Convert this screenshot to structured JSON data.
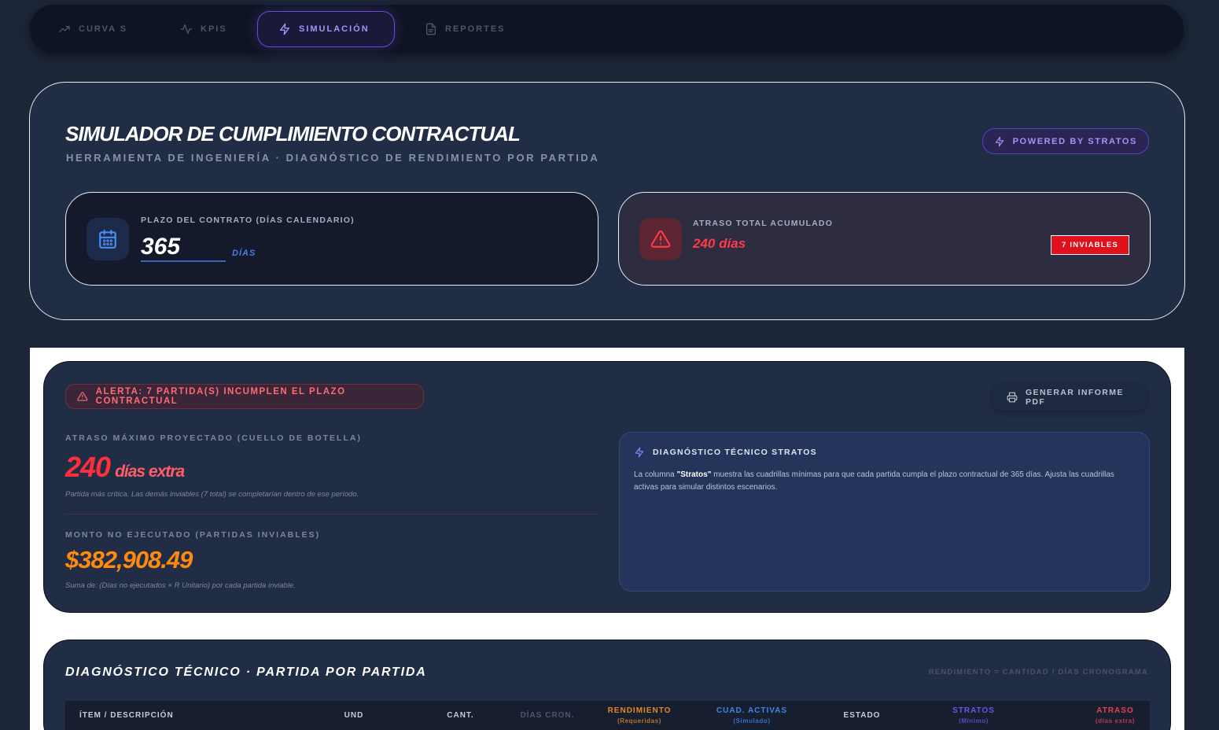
{
  "tabs": [
    {
      "label": "CURVA S",
      "icon": "trending-up-icon"
    },
    {
      "label": "KPIS",
      "icon": "activity-icon"
    },
    {
      "label": "SIMULACIÓN",
      "icon": "lightning-icon"
    },
    {
      "label": "REPORTES",
      "icon": "document-icon"
    }
  ],
  "header": {
    "title": "SIMULADOR DE CUMPLIMIENTO CONTRACTUAL",
    "subtitle": "HERRAMIENTA DE INGENIERÍA · DIAGNÓSTICO DE RENDIMIENTO POR PARTIDA",
    "powered": "POWERED BY STRATOS"
  },
  "contract": {
    "label": "PLAZO DEL CONTRATO (DÍAS CALENDARIO)",
    "value": "365",
    "unit": "DÍAS"
  },
  "delay": {
    "label": "ATRASO TOTAL ACUMULADO",
    "value": "240 días",
    "badge": "7 INVIABLES"
  },
  "alert": {
    "text": "ALERTA: 7 PARTIDA(S) INCUMPLEN EL PLAZO CONTRACTUAL",
    "pdf_button": "GENERAR INFORME PDF",
    "max_delay": {
      "label": "ATRASO MÁXIMO PROYECTADO (CUELLO DE BOTELLA)",
      "value": "240",
      "suffix": "días extra",
      "note": "Partida más crítica. Las demás inviables (7 total) se completarían dentro de ese período."
    },
    "amount": {
      "label": "MONTO NO EJECUTADO (PARTIDAS INVIABLES)",
      "value": "$382,908.49",
      "note": "Suma de: (Días no ejecutados × R Unitario) por cada partida inviable."
    },
    "diagnostic": {
      "title": "DIAGNÓSTICO TÉCNICO STRATOS",
      "text_before": "La columna ",
      "text_bold": "\"Stratos\"",
      "text_after": " muestra las cuadrillas mínimas para que cada partida cumpla el plazo contractual de 365 días. Ajusta las cuadrillas activas para simular distintos escenarios."
    }
  },
  "table": {
    "title": "DIAGNÓSTICO TÉCNICO · PARTIDA POR PARTIDA",
    "formula": "RENDIMIENTO = CANTIDAD / DÍAS CRONOGRAMA",
    "columns": [
      {
        "label": "ÍTEM / DESCRIPCIÓN",
        "sub": "",
        "color": "#c5cdda"
      },
      {
        "label": "UND",
        "sub": "",
        "color": "#c5cdda"
      },
      {
        "label": "CANT.",
        "sub": "",
        "color": "#c5cdda"
      },
      {
        "label": "DÍAS CRON.",
        "sub": "",
        "color": "#4d566a"
      },
      {
        "label": "RENDIMIENTO",
        "sub": "(Requeridas)",
        "color": "#e08a1e"
      },
      {
        "label": "CUAD. ACTIVAS",
        "sub": "(Simulado)",
        "color": "#3f86e6"
      },
      {
        "label": "ESTADO",
        "sub": "",
        "color": "#c5cdda"
      },
      {
        "label": "STRATOS",
        "sub": "(Mínimo)",
        "color": "#6d55e0"
      },
      {
        "label": "ATRASO",
        "sub": "(días extra)",
        "color": "#e8404c"
      }
    ]
  },
  "colors": {
    "accent": "#a594f7",
    "danger": "#ff3b48",
    "amount": "#ff8a10",
    "blue": "#4a7fe0"
  }
}
